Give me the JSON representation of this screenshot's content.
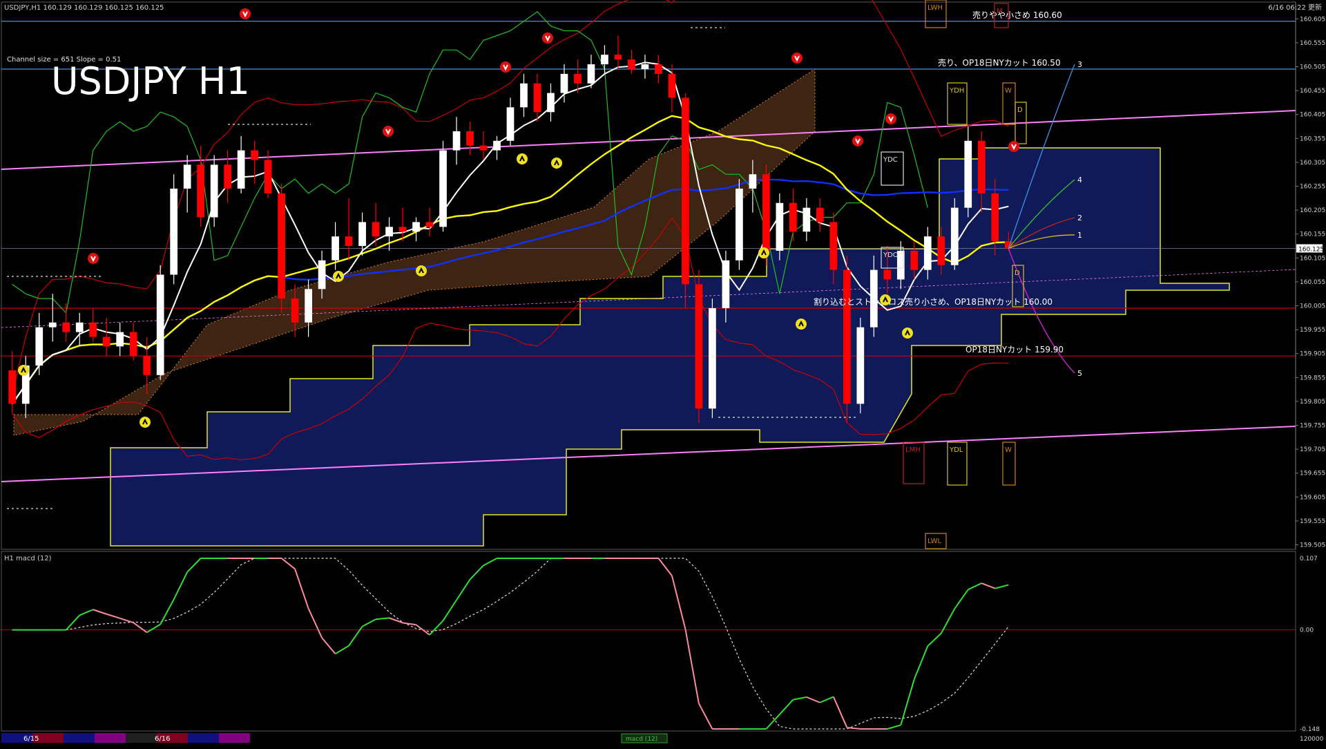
{
  "header": {
    "symbol_line": "USDJPY,H1  160.129 160.129 160.125 160.125",
    "time_right": "6/16 06:22 更新"
  },
  "main_title": "USDJPY H1",
  "channel_info": "Channel size = 651 Slope = 0.51",
  "annotations": [
    {
      "text": "売りやや小さめ 160.60",
      "price": 160.6
    },
    {
      "text": "売り、OP18日NYカット 160.50",
      "price": 160.5
    },
    {
      "text": "割り込むとストップロス売り小さめ、OP18日NYカット 160.00",
      "price": 160.0
    },
    {
      "text": "OP18日NYカット 159.90",
      "price": 159.9
    }
  ],
  "projection_labels": [
    "3",
    "4",
    "2",
    "1",
    "5"
  ],
  "box_labels": [
    "LWH",
    "M",
    "YDH",
    "W",
    "D",
    "YDC",
    "YDO",
    "D",
    "YDL",
    "W",
    "LMH",
    "LWL"
  ],
  "current_price": "160.125",
  "colors": {
    "background": "#000000",
    "bull_candle": "#ffffff",
    "bear_candle": "#ff0000",
    "ma_fast": "#ffffff",
    "ma_mid": "#ffff00",
    "ma_slow": "#1030ff",
    "bollinger": "#cc0000",
    "green_line": "#20c020",
    "channel": "#ff80ff",
    "cloud_blue": "#1e2fa0",
    "cloud_orange": "#e08040",
    "macd_up": "#30e030",
    "macd_down": "#ff8aa0"
  },
  "macd_panel": {
    "label": "H1  macd (12)",
    "axis_ticks": [
      "0.107",
      "0.00",
      "-0.148"
    ]
  },
  "bottom_bar": {
    "dates": [
      "6/15",
      "6/16"
    ],
    "center_label": "macd (12)",
    "right_label": "120000"
  },
  "chart_data": {
    "type": "candlestick",
    "title": "USDJPY H1",
    "ylim": [
      159.5,
      160.63
    ],
    "y_ticks": [
      "160.605",
      "160.555",
      "160.505",
      "160.455",
      "160.405",
      "160.355",
      "160.305",
      "160.255",
      "160.205",
      "160.155",
      "160.105",
      "160.055",
      "160.005",
      "159.955",
      "159.905",
      "159.855",
      "159.805",
      "159.755",
      "159.705",
      "159.655",
      "159.605",
      "159.555",
      "159.505"
    ],
    "horizontal_levels": [
      160.6,
      160.5,
      160.0,
      159.9
    ],
    "candles": [
      {
        "o": 159.87,
        "h": 159.91,
        "l": 159.78,
        "c": 159.8
      },
      {
        "o": 159.8,
        "h": 159.9,
        "l": 159.77,
        "c": 159.88
      },
      {
        "o": 159.88,
        "h": 159.99,
        "l": 159.86,
        "c": 159.96
      },
      {
        "o": 159.96,
        "h": 160.03,
        "l": 159.93,
        "c": 159.97
      },
      {
        "o": 159.97,
        "h": 160.01,
        "l": 159.93,
        "c": 159.95
      },
      {
        "o": 159.95,
        "h": 159.99,
        "l": 159.92,
        "c": 159.97
      },
      {
        "o": 159.97,
        "h": 160.0,
        "l": 159.93,
        "c": 159.94
      },
      {
        "o": 159.94,
        "h": 159.98,
        "l": 159.9,
        "c": 159.92
      },
      {
        "o": 159.92,
        "h": 159.97,
        "l": 159.9,
        "c": 159.95
      },
      {
        "o": 159.95,
        "h": 159.97,
        "l": 159.89,
        "c": 159.9
      },
      {
        "o": 159.9,
        "h": 159.94,
        "l": 159.82,
        "c": 159.86
      },
      {
        "o": 159.86,
        "h": 160.09,
        "l": 159.85,
        "c": 160.07
      },
      {
        "o": 160.07,
        "h": 160.28,
        "l": 160.05,
        "c": 160.25
      },
      {
        "o": 160.25,
        "h": 160.32,
        "l": 160.2,
        "c": 160.3
      },
      {
        "o": 160.3,
        "h": 160.34,
        "l": 160.17,
        "c": 160.19
      },
      {
        "o": 160.19,
        "h": 160.32,
        "l": 160.17,
        "c": 160.3
      },
      {
        "o": 160.3,
        "h": 160.33,
        "l": 160.22,
        "c": 160.25
      },
      {
        "o": 160.25,
        "h": 160.36,
        "l": 160.24,
        "c": 160.33
      },
      {
        "o": 160.33,
        "h": 160.35,
        "l": 160.26,
        "c": 160.31
      },
      {
        "o": 160.31,
        "h": 160.33,
        "l": 160.23,
        "c": 160.24
      },
      {
        "o": 160.24,
        "h": 160.26,
        "l": 159.99,
        "c": 160.02
      },
      {
        "o": 160.02,
        "h": 160.05,
        "l": 159.94,
        "c": 159.97
      },
      {
        "o": 159.97,
        "h": 160.06,
        "l": 159.94,
        "c": 160.04
      },
      {
        "o": 160.04,
        "h": 160.12,
        "l": 160.02,
        "c": 160.1
      },
      {
        "o": 160.1,
        "h": 160.18,
        "l": 160.08,
        "c": 160.15
      },
      {
        "o": 160.15,
        "h": 160.23,
        "l": 160.1,
        "c": 160.13
      },
      {
        "o": 160.13,
        "h": 160.2,
        "l": 160.11,
        "c": 160.18
      },
      {
        "o": 160.18,
        "h": 160.22,
        "l": 160.13,
        "c": 160.15
      },
      {
        "o": 160.15,
        "h": 160.19,
        "l": 160.12,
        "c": 160.17
      },
      {
        "o": 160.17,
        "h": 160.21,
        "l": 160.14,
        "c": 160.16
      },
      {
        "o": 160.16,
        "h": 160.19,
        "l": 160.14,
        "c": 160.18
      },
      {
        "o": 160.18,
        "h": 160.21,
        "l": 160.15,
        "c": 160.17
      },
      {
        "o": 160.17,
        "h": 160.35,
        "l": 160.16,
        "c": 160.33
      },
      {
        "o": 160.33,
        "h": 160.4,
        "l": 160.3,
        "c": 160.37
      },
      {
        "o": 160.37,
        "h": 160.39,
        "l": 160.32,
        "c": 160.34
      },
      {
        "o": 160.34,
        "h": 160.37,
        "l": 160.31,
        "c": 160.33
      },
      {
        "o": 160.33,
        "h": 160.36,
        "l": 160.31,
        "c": 160.35
      },
      {
        "o": 160.35,
        "h": 160.44,
        "l": 160.34,
        "c": 160.42
      },
      {
        "o": 160.42,
        "h": 160.49,
        "l": 160.4,
        "c": 160.47
      },
      {
        "o": 160.47,
        "h": 160.49,
        "l": 160.39,
        "c": 160.41
      },
      {
        "o": 160.41,
        "h": 160.47,
        "l": 160.39,
        "c": 160.45
      },
      {
        "o": 160.45,
        "h": 160.51,
        "l": 160.43,
        "c": 160.49
      },
      {
        "o": 160.49,
        "h": 160.52,
        "l": 160.45,
        "c": 160.47
      },
      {
        "o": 160.47,
        "h": 160.53,
        "l": 160.46,
        "c": 160.51
      },
      {
        "o": 160.51,
        "h": 160.55,
        "l": 160.49,
        "c": 160.53
      },
      {
        "o": 160.53,
        "h": 160.57,
        "l": 160.5,
        "c": 160.52
      },
      {
        "o": 160.52,
        "h": 160.54,
        "l": 160.49,
        "c": 160.5
      },
      {
        "o": 160.5,
        "h": 160.53,
        "l": 160.48,
        "c": 160.51
      },
      {
        "o": 160.51,
        "h": 160.53,
        "l": 160.47,
        "c": 160.49
      },
      {
        "o": 160.49,
        "h": 160.51,
        "l": 160.41,
        "c": 160.44
      },
      {
        "o": 160.44,
        "h": 160.45,
        "l": 160.0,
        "c": 160.05
      },
      {
        "o": 160.05,
        "h": 160.08,
        "l": 159.76,
        "c": 159.79
      },
      {
        "o": 159.79,
        "h": 160.02,
        "l": 159.77,
        "c": 160.0
      },
      {
        "o": 160.0,
        "h": 160.12,
        "l": 159.97,
        "c": 160.1
      },
      {
        "o": 160.1,
        "h": 160.27,
        "l": 160.08,
        "c": 160.25
      },
      {
        "o": 160.25,
        "h": 160.31,
        "l": 160.2,
        "c": 160.28
      },
      {
        "o": 160.28,
        "h": 160.3,
        "l": 160.09,
        "c": 160.12
      },
      {
        "o": 160.12,
        "h": 160.24,
        "l": 160.1,
        "c": 160.22
      },
      {
        "o": 160.22,
        "h": 160.25,
        "l": 160.14,
        "c": 160.16
      },
      {
        "o": 160.16,
        "h": 160.23,
        "l": 160.14,
        "c": 160.21
      },
      {
        "o": 160.21,
        "h": 160.23,
        "l": 160.16,
        "c": 160.18
      },
      {
        "o": 160.18,
        "h": 160.2,
        "l": 160.05,
        "c": 160.08
      },
      {
        "o": 160.08,
        "h": 160.11,
        "l": 159.76,
        "c": 159.8
      },
      {
        "o": 159.8,
        "h": 159.98,
        "l": 159.78,
        "c": 159.96
      },
      {
        "o": 159.96,
        "h": 160.11,
        "l": 159.94,
        "c": 160.08
      },
      {
        "o": 160.08,
        "h": 160.13,
        "l": 160.03,
        "c": 160.06
      },
      {
        "o": 160.06,
        "h": 160.14,
        "l": 160.04,
        "c": 160.12
      },
      {
        "o": 160.12,
        "h": 160.14,
        "l": 160.06,
        "c": 160.08
      },
      {
        "o": 160.08,
        "h": 160.17,
        "l": 160.06,
        "c": 160.15
      },
      {
        "o": 160.15,
        "h": 160.17,
        "l": 160.07,
        "c": 160.09
      },
      {
        "o": 160.09,
        "h": 160.23,
        "l": 160.08,
        "c": 160.21
      },
      {
        "o": 160.21,
        "h": 160.38,
        "l": 160.19,
        "c": 160.35
      },
      {
        "o": 160.35,
        "h": 160.37,
        "l": 160.2,
        "c": 160.24
      },
      {
        "o": 160.24,
        "h": 160.27,
        "l": 160.11,
        "c": 160.14
      },
      {
        "o": 160.14,
        "h": 160.16,
        "l": 160.12,
        "c": 160.125
      }
    ]
  }
}
